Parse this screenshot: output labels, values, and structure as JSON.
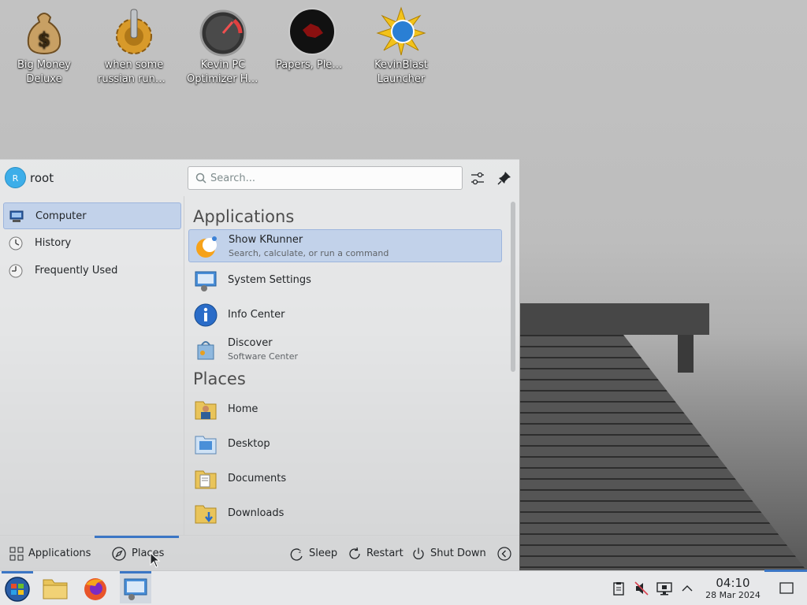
{
  "desktop": {
    "icons": [
      {
        "label1": "Big Money",
        "label2": "Deluxe",
        "icon": "money-bag-icon"
      },
      {
        "label1": "when some",
        "label2": "russian runs a...",
        "icon": "gear-icon"
      },
      {
        "label1": "Kevin PC",
        "label2": "Optimizer Ho...",
        "icon": "speedometer-icon"
      },
      {
        "label1": "Papers, Please",
        "label2": "",
        "icon": "papers-please-icon"
      },
      {
        "label1": "KevinBlast",
        "label2": "Launcher",
        "icon": "kevinblast-icon"
      }
    ]
  },
  "menu": {
    "user": {
      "avatar_letter": "R",
      "name": "root"
    },
    "search": {
      "placeholder": "Search..."
    },
    "sidebar": [
      {
        "label": "Computer",
        "icon": "computer-icon",
        "active": true
      },
      {
        "label": "History",
        "icon": "history-icon",
        "active": false
      },
      {
        "label": "Frequently Used",
        "icon": "clock-icon",
        "active": false
      }
    ],
    "sections": {
      "applications": "Applications",
      "places": "Places"
    },
    "applications": [
      {
        "name": "Show KRunner",
        "desc": "Search, calculate, or run a command",
        "icon": "krunner-icon",
        "active": true
      },
      {
        "name": "System Settings",
        "desc": "",
        "icon": "system-settings-icon",
        "active": false
      },
      {
        "name": "Info Center",
        "desc": "",
        "icon": "info-icon",
        "active": false
      },
      {
        "name": "Discover",
        "desc": "Software Center",
        "icon": "discover-icon",
        "active": false
      }
    ],
    "places": [
      {
        "name": "Home",
        "icon": "home-folder-icon"
      },
      {
        "name": "Desktop",
        "icon": "desktop-folder-icon"
      },
      {
        "name": "Documents",
        "icon": "documents-folder-icon"
      },
      {
        "name": "Downloads",
        "icon": "downloads-folder-icon"
      }
    ],
    "footer": {
      "tab_applications": "Applications",
      "tab_places": "Places",
      "sleep": "Sleep",
      "restart": "Restart",
      "shutdown": "Shut Down"
    }
  },
  "taskbar": {
    "clock_time": "04:10",
    "clock_date": "28 Mar 2024"
  },
  "colors": {
    "accent": "#3b76c5",
    "highlight": "#c2d2ea"
  }
}
